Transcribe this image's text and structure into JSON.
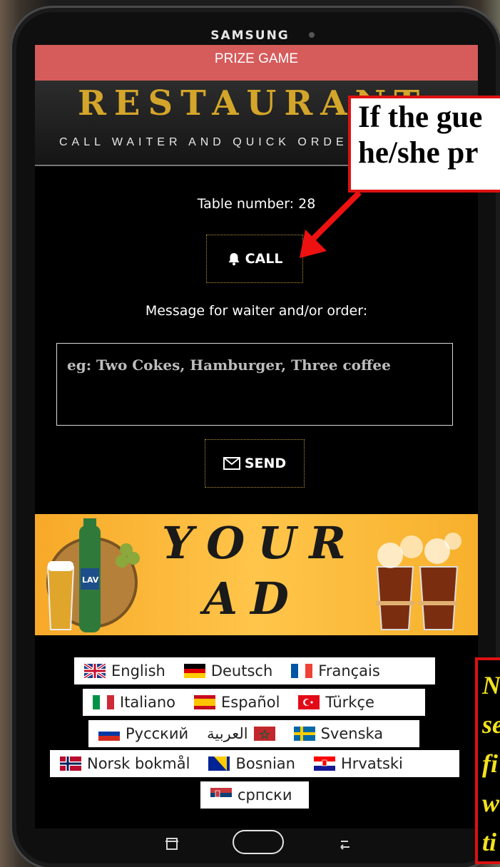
{
  "device": {
    "brand": "SAMSUNG"
  },
  "app": {
    "prize_bar": "PRIZE GAME",
    "logo": "RESTAURANT",
    "tagline": "CALL WAITER AND QUICK ORDERING",
    "table_number": "Table number: 28",
    "call_label": "CALL",
    "message_label": "Message for waiter and/or order:",
    "message_placeholder": "eg: Two Cokes, Hamburger, Three coffee",
    "send_label": "SEND"
  },
  "ad": {
    "line1": "YOUR",
    "line2": "AD",
    "beer_brand": "LAV"
  },
  "languages": [
    {
      "label": "English",
      "flag": "uk-flag"
    },
    {
      "label": "Deutsch",
      "flag": "germany-flag"
    },
    {
      "label": "Français",
      "flag": "france-flag"
    },
    {
      "label": "Italiano",
      "flag": "italy-flag"
    },
    {
      "label": "Español",
      "flag": "spain-flag"
    },
    {
      "label": "Türkçe",
      "flag": "turkey-flag"
    },
    {
      "label": "Русский",
      "flag": "russia-flag"
    },
    {
      "label": "العربية",
      "flag": "morocco-flag"
    },
    {
      "label": "Svenska",
      "flag": "sweden-flag"
    },
    {
      "label": "Norsk bokmål",
      "flag": "norway-flag"
    },
    {
      "label": "Bosnian",
      "flag": "bosnia-flag"
    },
    {
      "label": "Hrvatski",
      "flag": "croatia-flag"
    },
    {
      "label": "српски",
      "flag": "serbia-flag"
    }
  ],
  "callouts": {
    "top_line1": "If the gue",
    "top_line2": "he/she pr",
    "bottom_lines": [
      "N",
      "se",
      "fi",
      "w",
      "ti"
    ]
  },
  "colors": {
    "prize_bar": "#d65b5b",
    "logo_gold": "#d3a52a",
    "callout_border": "#dd1111",
    "callout_yellow": "#f2e21c"
  }
}
